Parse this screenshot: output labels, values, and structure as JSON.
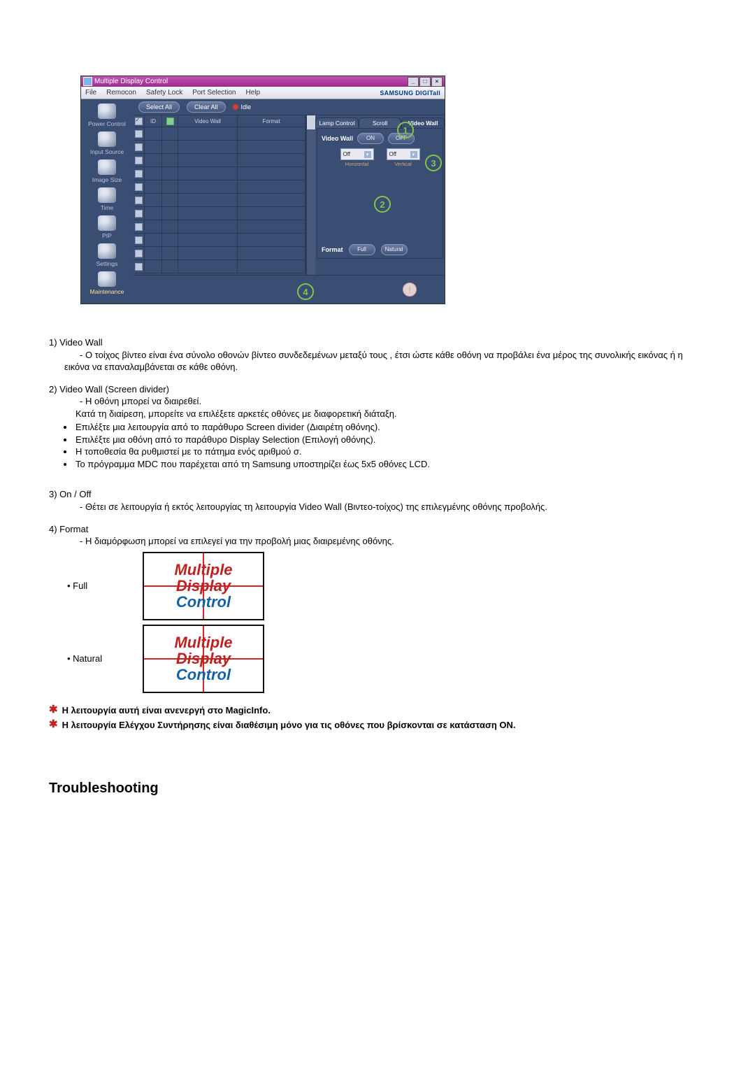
{
  "window": {
    "title": "Multiple Display Control",
    "menubar": [
      "File",
      "Remocon",
      "Safety Lock",
      "Port Selection",
      "Help"
    ],
    "brand": "SAMSUNG DIGITall"
  },
  "sidebar": {
    "items": [
      {
        "label": "Power Control"
      },
      {
        "label": "Input Source"
      },
      {
        "label": "Image Size"
      },
      {
        "label": "Time"
      },
      {
        "label": "PIP"
      },
      {
        "label": "Settings"
      },
      {
        "label": "Maintenance"
      }
    ]
  },
  "topctrl": {
    "select_all": "Select All",
    "clear_all": "Clear All",
    "idle": "Idle"
  },
  "grid": {
    "headers": {
      "id": "ID",
      "video_wall": "Video Wall",
      "format": "Format"
    },
    "rows": 11
  },
  "right": {
    "tabs": [
      "Lamp Control",
      "Scroll",
      "Video Wall"
    ],
    "active_tab": 2,
    "video_wall_label": "Video Wall",
    "on_label": "ON",
    "off_label": "OFF",
    "drop_horizontal": {
      "value": "Off",
      "label": "Horizontal"
    },
    "drop_vertical": {
      "value": "Off",
      "label": "Vertical"
    },
    "format_label": "Format",
    "format_full": "Full",
    "format_natural": "Natural"
  },
  "callouts": {
    "c1": "1",
    "c2": "2",
    "c3": "3",
    "c4": "4"
  },
  "doc": {
    "i1_title": "1)  Video Wall",
    "i1_a": "Ο τοίχος βίντεο είναι ένα σύνολο οθονών βίντεο συνδεδεμένων μεταξύ τους , έτσι ώστε κάθε οθόνη να προβάλει ένα μέρος της συνολικής εικόνας ή η εικόνα να επαναλαμβάνεται σε κάθε οθόνη.",
    "i2_title": "2)  Video Wall (Screen divider)",
    "i2_a": "Η οθόνη μπορεί να διαιρεθεί.",
    "i2_b": "Κατά τη διαίρεση, μπορείτε να επιλέξετε αρκετές οθόνες με διαφορετική διάταξη.",
    "i2_bullets": [
      "Επιλέξτε μια λειτουργία από το παράθυρο Screen divider (Διαιρέτη οθόνης).",
      "Επιλέξτε μια οθόνη από το παράθυρο Display Selection (Επιλογή οθόνης).",
      "Η τοποθεσία θα ρυθμιστεί με το πάτημα ενός αριθμού σ.",
      "Το πρόγραμμα MDC που παρέχεται από τη Samsung υποστηρίζει έως 5x5 οθόνες LCD."
    ],
    "i3_title": "3)  On / Off",
    "i3_a": "Θέτει σε λειτουργία ή εκτός λειτουργίας τη λειτουργία Video Wall (Βιντεο-τοίχος) της επιλεγμένης οθόνης προβολής.",
    "i4_title": "4)  Format",
    "i4_a": "Η διαμόρφωση μπορεί να επιλεγεί για την προβολή μιας διαιρεμένης οθόνης.",
    "ex_full": "Full",
    "ex_natural": "Natural",
    "tile_line1": "Multiple",
    "tile_line2": "Display",
    "tile_line3": "Control",
    "note1": "Η λειτουργία αυτή είναι ανενεργή στο MagicInfo.",
    "note2": "Η λειτουργία Ελέγχου Συντήρησης είναι διαθέσιμη μόνο για τις οθόνες που βρίσκονται σε κατάσταση ON."
  },
  "troubleshoot_title": "Troubleshooting"
}
